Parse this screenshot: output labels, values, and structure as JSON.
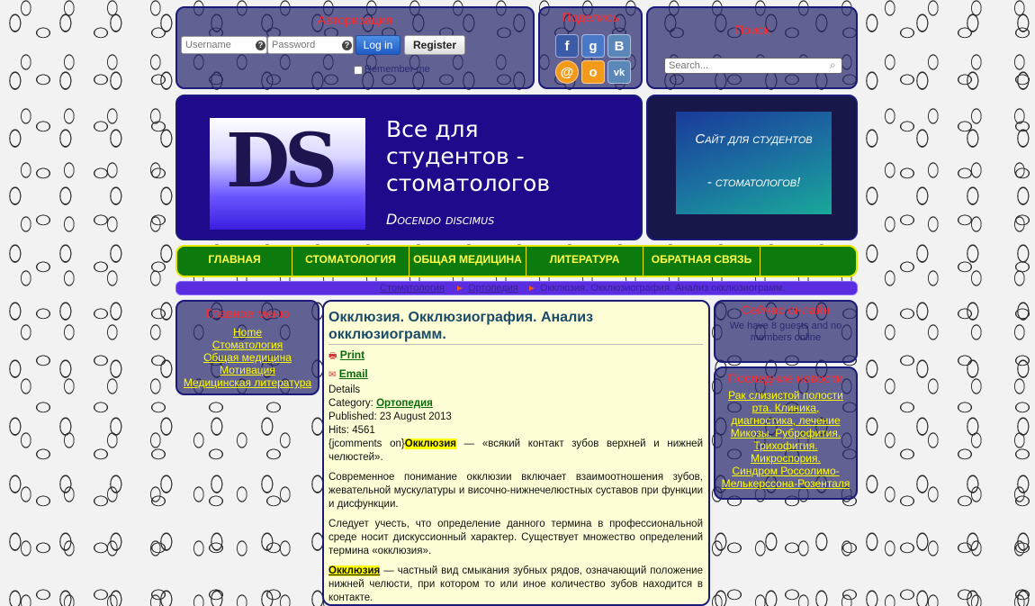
{
  "auth": {
    "title": "Авторизация",
    "username_placeholder": "Username",
    "password_placeholder": "Password",
    "login_label": "Log in",
    "register_label": "Register",
    "remember_label": "Remember me"
  },
  "share": {
    "title": "Поделись"
  },
  "search": {
    "title": "Поиск",
    "placeholder": "Search..."
  },
  "banner": {
    "logo_letters": "DS",
    "line1": "Все для",
    "line2": "студентов -",
    "line3": "стоматологов",
    "motto": "Docendo discimus"
  },
  "promo": {
    "line1": "Сайт для студентов",
    "line2": "- стоматологов!"
  },
  "nav": {
    "items": [
      "ГЛАВНАЯ",
      "СТОМАТОЛОГИЯ",
      "ОБЩАЯ МЕДИЦИНА",
      "ЛИТЕРАТУРА",
      "ОБРАТНАЯ СВЯЗЬ"
    ]
  },
  "breadcrumb": {
    "items": [
      "Стоматология",
      "Ортопедия",
      "Окклюзия. Окклюзиография. Анализ окклюзиограмм."
    ]
  },
  "main_menu": {
    "title": "Главное меню",
    "items": [
      "Home",
      "Стоматология",
      "Общая медицина",
      "Мотивация",
      "Медицинская литература"
    ]
  },
  "article": {
    "title": "Окклюзия. Окклюзиография. Анализ окклюзиограмм.",
    "print_label": "Print",
    "email_label": "Email",
    "details_label": "Details",
    "category_label": "Category:",
    "category_value": "Ортопедия",
    "published": "Published: 23 August 2013",
    "hits": "Hits: 4561",
    "p1_prefix": "{jcomments on}",
    "p1_keyword": "Окклюзия",
    "p1_rest": " — «всякий контакт зубов верхней и нижней челюстей».",
    "p2": "Современное понимание окклюзии включает взаимоотношения зубов, жевательной мускулатуры и височно-нижнечелюстных суставов при функции и дисфункции.",
    "p3": "Следует учесть, что определение данного термина в профессиональной среде носит дискуссионный характер. Существует множество определений термина «окклюзия».",
    "p4_keyword": "Окклюзия",
    "p4_rest": " — частный вид смыкания зубных рядов, означающий положение нижней челюсти, при котором то или иное количество зубов находится в контакте."
  },
  "online": {
    "title": "Сейчас онлайн",
    "text": "We have 8 guests and no members online"
  },
  "news": {
    "title": "Последние новости",
    "items": [
      "Рак слизистой полости рта. Клиника, диагностика, лечение",
      "Микозы. Руброфития. Трихофития. Микроспория.",
      "Синдром Россолимо-Мелькерссона-Розенталя"
    ]
  },
  "colors": {
    "panel": "#28286e",
    "nav_bg": "#0c7a0c",
    "nav_text": "#ffff4a",
    "title_red": "#ff2a2a",
    "article_bg": "#fefed6"
  }
}
